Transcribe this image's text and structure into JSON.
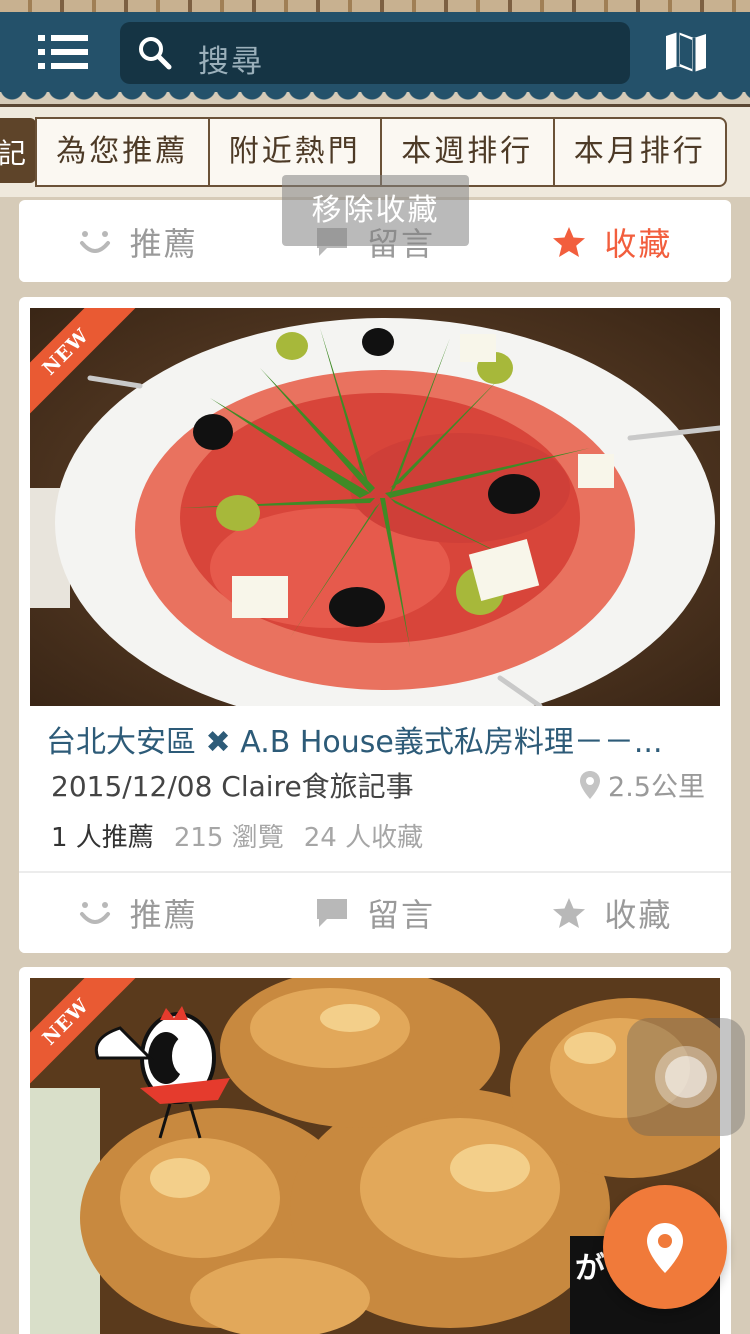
{
  "header": {
    "search_placeholder": "搜尋",
    "menu_icon": "list-icon",
    "map_icon": "map-icon"
  },
  "tabs": {
    "partial_first": "記",
    "items": [
      "為您推薦",
      "附近熱門",
      "本週排行",
      "本月排行"
    ]
  },
  "toast": "移除收藏",
  "actions": {
    "recommend": "推薦",
    "comment": "留言",
    "favorite": "收藏"
  },
  "cards": [
    {
      "badge": "NEW",
      "title": "台北大安區 ✖ A.B House義式私房料理－－...",
      "date_author": "2015/12/08 Claire食旅記事",
      "distance": "2.5公里",
      "recommends": "1 人推薦",
      "views": "215 瀏覽",
      "favorites": "24 人收藏"
    },
    {
      "badge": "NEW",
      "image_text": "がブリチキン。ほじ鳥"
    }
  ],
  "colors": {
    "header": "#24516a",
    "accent": "#f25e3d",
    "fab": "#f07a3a",
    "title": "#2d5b78"
  }
}
